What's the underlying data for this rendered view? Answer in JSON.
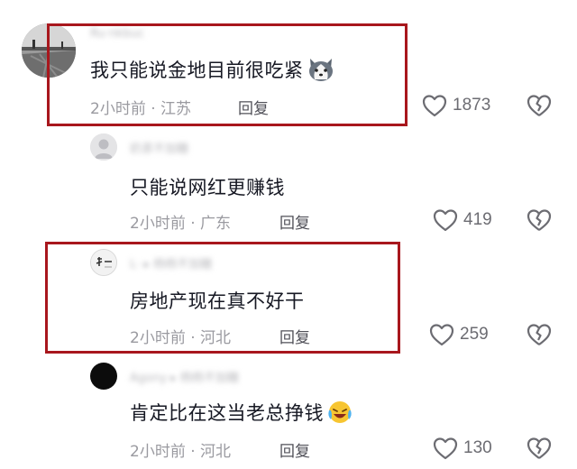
{
  "comments": [
    {
      "username": "Ru·nkbuc",
      "text": "我只能说金地目前很吃紧",
      "meta": "2小时前 · 江苏",
      "reply_label": "回复",
      "likes": "1873",
      "emoji_icon": "husky-face-icon"
    },
    {
      "username": "奶茶不加糖",
      "text": "只能说网红更赚钱",
      "meta": "2小时前 · 广东",
      "reply_label": "回复",
      "likes": "419"
    },
    {
      "username": "L· ▸ 杨杨不加糖",
      "text": "房地产现在真不好干",
      "meta": "2小时前 · 河北",
      "reply_label": "回复",
      "likes": "259"
    },
    {
      "username": "Agony ▸ 杨杨不加糖",
      "text": "肯定比在这当老总挣钱",
      "meta": "2小时前 · 河北",
      "reply_label": "回复",
      "likes": "130",
      "emoji_icon": "laughing-crying-face-icon"
    }
  ],
  "colors": {
    "highlight_border": "#a8171d",
    "meta_text": "#9a9aa0",
    "comment_text": "#161823"
  }
}
